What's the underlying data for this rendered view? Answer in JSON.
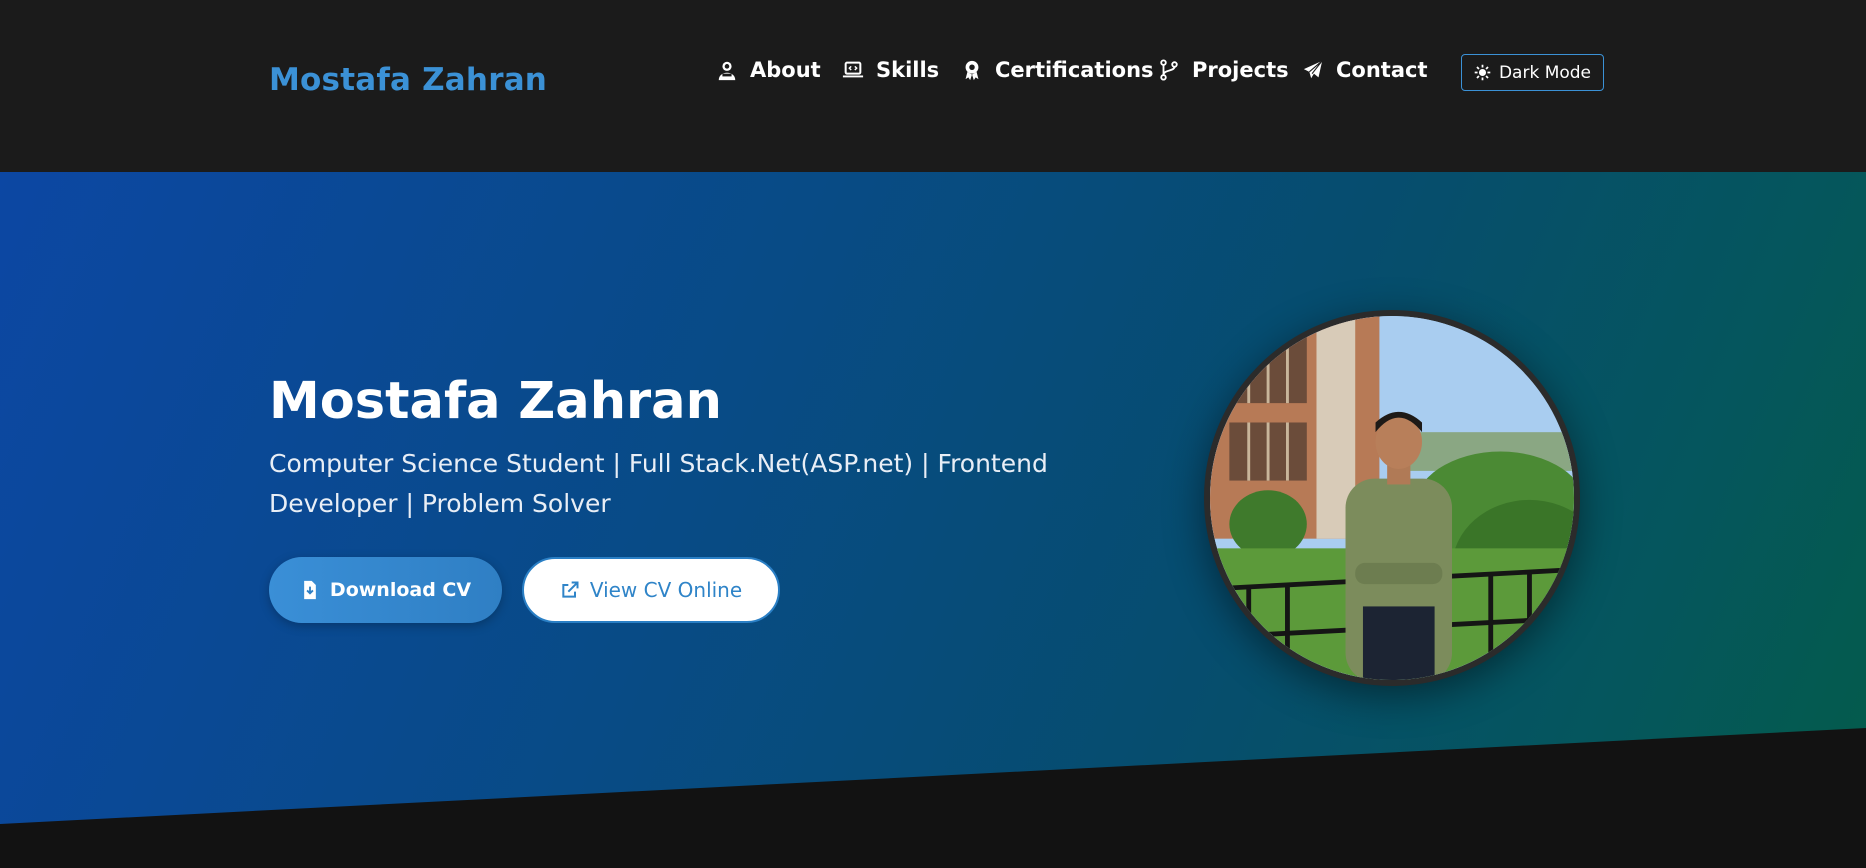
{
  "header": {
    "brand": "Mostafa Zahran",
    "nav": [
      {
        "label": "About",
        "icon": "user-icon"
      },
      {
        "label": "Skills",
        "icon": "laptop-code-icon"
      },
      {
        "label": "Certifications",
        "icon": "award-icon"
      },
      {
        "label": "Projects",
        "icon": "code-branch-icon"
      },
      {
        "label": "Contact",
        "icon": "paper-plane-icon"
      }
    ],
    "theme_toggle": {
      "label": "Dark Mode",
      "icon": "sun-icon"
    }
  },
  "hero": {
    "name": "Mostafa Zahran",
    "subtitle": "Computer Science Student | Full Stack.Net(ASP.net) | Frontend Developer | Problem Solver",
    "download_button": {
      "label": "Download CV",
      "icon": "file-download-icon"
    },
    "view_button": {
      "label": "View CV Online",
      "icon": "external-link-icon"
    },
    "photo": "profile-photo"
  },
  "colors": {
    "header_bg": "#1b1b1b",
    "brand_accent": "#3b91d6",
    "hero_gradient_start": "#0c47a3",
    "hero_gradient_end": "#045c4a",
    "page_bg": "#121212"
  }
}
